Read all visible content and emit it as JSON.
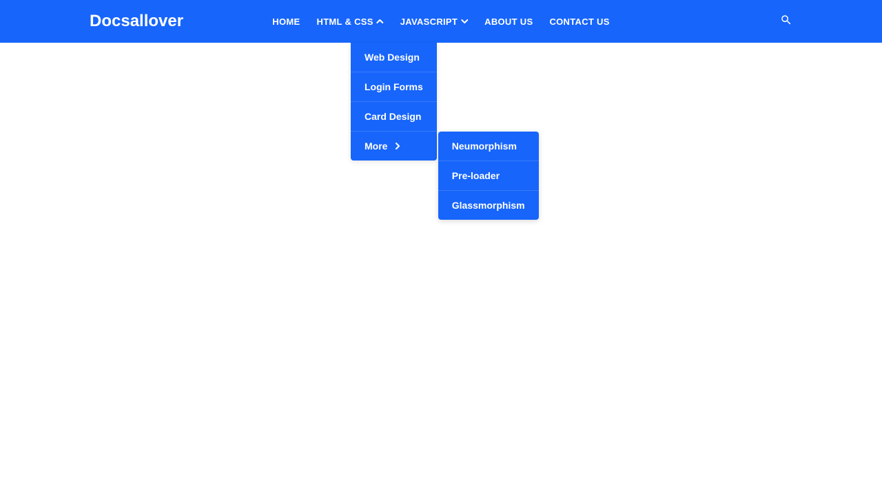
{
  "brand": "Docsallover",
  "nav": {
    "home": "HOME",
    "htmlcss": "HTML & CSS",
    "javascript": "JAVASCRIPT",
    "about": "ABOUT US",
    "contact": "CONTACT US"
  },
  "dropdown": {
    "webdesign": "Web Design",
    "loginforms": "Login Forms",
    "carddesign": "Card Design",
    "more": "More"
  },
  "submenu": {
    "neumorphism": "Neumorphism",
    "preloader": "Pre-loader",
    "glassmorphism": "Glassmorphism"
  }
}
